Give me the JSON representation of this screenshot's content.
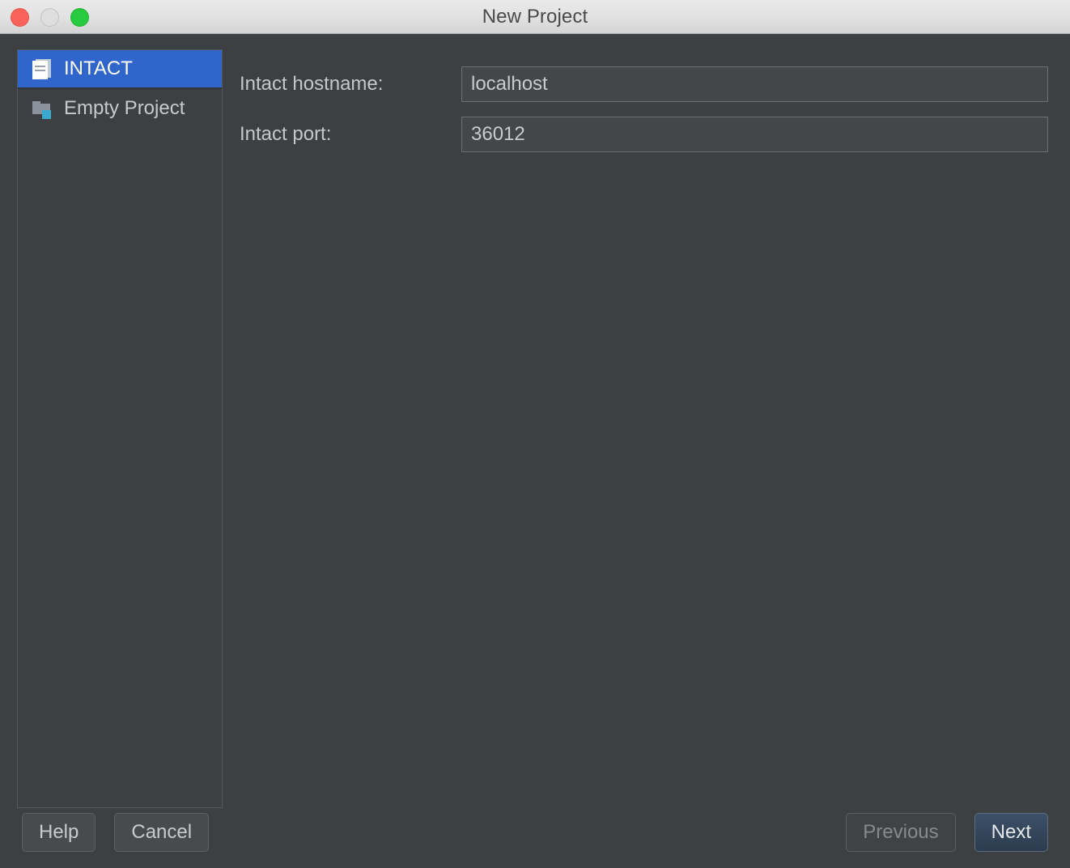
{
  "window": {
    "title": "New Project",
    "traffic_lights": [
      {
        "name": "close",
        "color": "#fb6259"
      },
      {
        "name": "minimize",
        "color": "#dedede"
      },
      {
        "name": "maximize",
        "color": "#28ca3f"
      }
    ]
  },
  "sidebar": {
    "items": [
      {
        "label": "INTACT",
        "icon": "document-icon",
        "selected": true
      },
      {
        "label": "Empty Project",
        "icon": "folder-icon",
        "selected": false
      }
    ]
  },
  "form": {
    "rows": [
      {
        "label": "Intact hostname:",
        "value": "localhost",
        "placeholder": ""
      },
      {
        "label": "Intact port:",
        "value": "36012",
        "placeholder": ""
      }
    ]
  },
  "footer": {
    "help_label": "Help",
    "cancel_label": "Cancel",
    "previous_label": "Previous",
    "next_label": "Next"
  },
  "colors": {
    "window_bg": "#3c4042",
    "titlebar_bg": "#e3e3e3",
    "selection_blue": "#3066cb",
    "accent_cyan": "#3aa9cf",
    "text_primary": "#c8cbcd",
    "text_disabled": "#868a8d",
    "primary_button": "#34455a"
  }
}
